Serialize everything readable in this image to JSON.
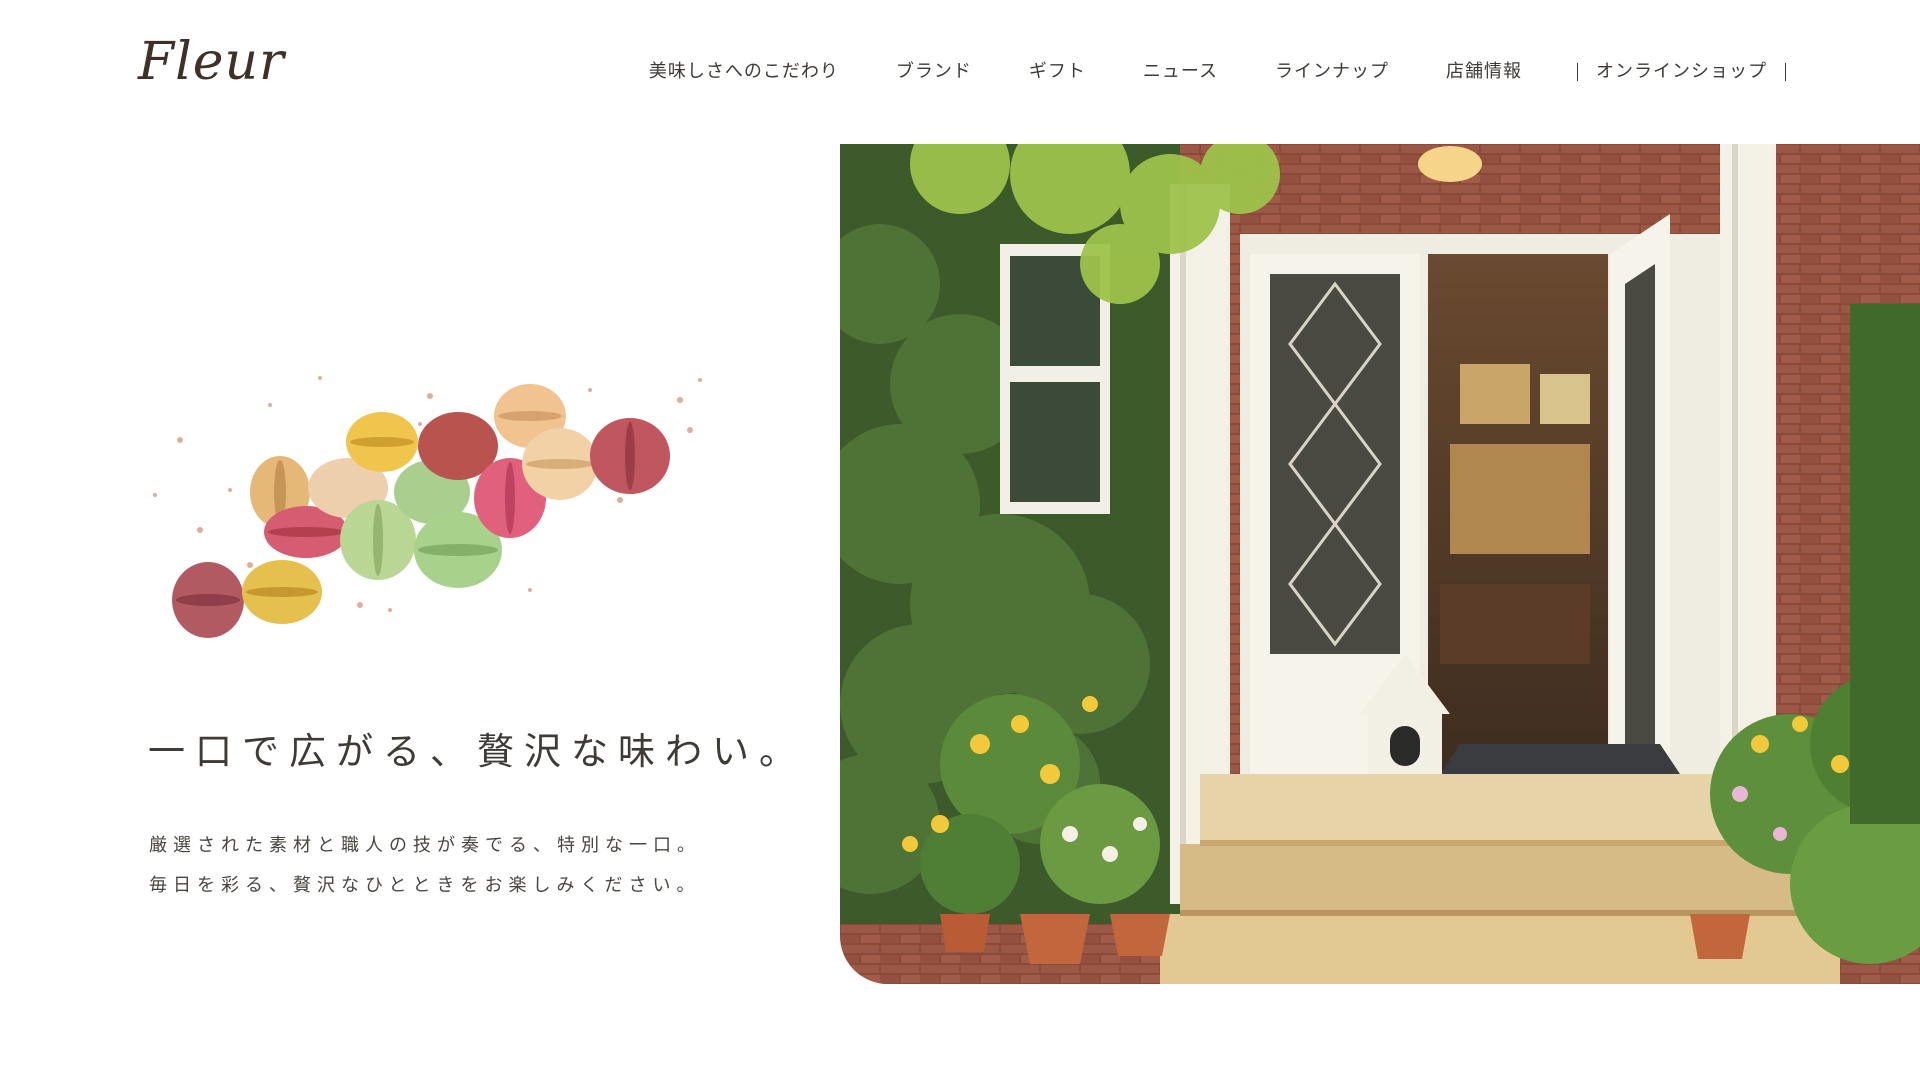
{
  "header": {
    "logo_text": "Fleur",
    "nav": [
      {
        "label": "美味しさへのこだわり"
      },
      {
        "label": "ブランド"
      },
      {
        "label": "ギフト"
      },
      {
        "label": "ニュース"
      },
      {
        "label": "ラインナップ"
      },
      {
        "label": "店舗情報"
      }
    ],
    "shop_label": "オンラインショップ"
  },
  "hero": {
    "headline": "一口で広がる、贅沢な味わい。",
    "description": [
      "厳選された素材と職人の技が奏でる、特別な一口。",
      "毎日を彩る、贅沢なひとときをお楽しみください。"
    ]
  },
  "colors": {
    "text": "#3e3a36",
    "background": "#ffffff",
    "logo": "#3f3128"
  }
}
